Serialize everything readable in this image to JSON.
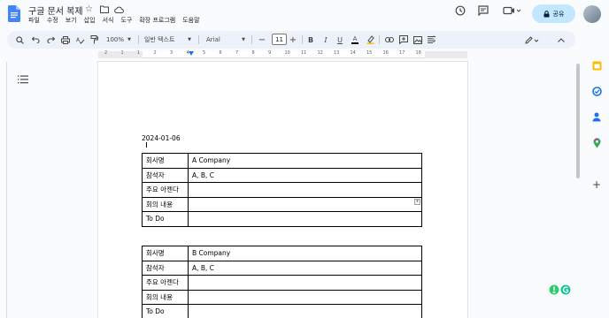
{
  "app": {
    "title": "구글 문서 복제",
    "menu": [
      "파일",
      "수정",
      "보기",
      "삽입",
      "서식",
      "도구",
      "확장 프로그램",
      "도움말"
    ],
    "share_label": "공유"
  },
  "toolbar": {
    "zoom": "100%",
    "style": "일반 텍스트",
    "font": "Arial",
    "font_size": "11"
  },
  "ruler_numbers": [
    "2",
    "1",
    "1",
    "2",
    "3",
    "4",
    "5",
    "6",
    "7",
    "8",
    "9",
    "10",
    "11",
    "12",
    "13",
    "14",
    "15",
    "16",
    "17",
    "18"
  ],
  "document": {
    "date": "2024-01-06",
    "tables": [
      {
        "rows": [
          {
            "label": "회사명",
            "value": "A Company"
          },
          {
            "label": "참석자",
            "value": "A, B, C"
          },
          {
            "label": "주요 아젠다",
            "value": ""
          },
          {
            "label": "회의 내용",
            "value": ""
          },
          {
            "label": "To Do",
            "value": ""
          }
        ]
      },
      {
        "rows": [
          {
            "label": "회사명",
            "value": "B Company"
          },
          {
            "label": "참석자",
            "value": "A, B, C"
          },
          {
            "label": "주요 아젠다",
            "value": ""
          },
          {
            "label": "회의 내용",
            "value": ""
          },
          {
            "label": "To Do",
            "value": ""
          }
        ]
      }
    ]
  },
  "colors": {
    "accent": "#1a73e8",
    "share_bg": "#c2e7ff",
    "toolbar_bg": "#edf2fa",
    "page_bg": "#f9fbfd"
  }
}
